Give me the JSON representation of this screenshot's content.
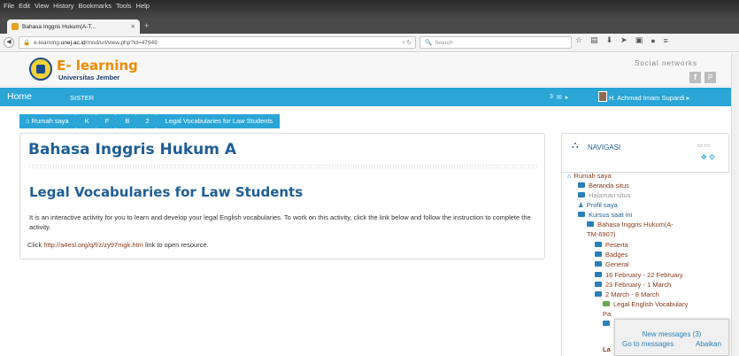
{
  "browser": {
    "menus": [
      "File",
      "Edit",
      "View",
      "History",
      "Bookmarks",
      "Tools",
      "Help"
    ],
    "tab_title": "Bahasa Inggris Hukum(A-T...",
    "url_prefix": "e-learning.",
    "url_host": "unej.ac.id",
    "url_path": "/mod/url/view.php?id=47949",
    "search_placeholder": "Search"
  },
  "site": {
    "logo_title": "E- learning",
    "logo_subtitle": "Universitas Jember",
    "social_label": "Social networks",
    "facebook_glyph": "f",
    "pinterest_glyph": "P"
  },
  "topnav": {
    "home": "Home",
    "sister": "SISTER",
    "messages_count": "3",
    "user_name": "H. Achmad Imam Supardi"
  },
  "breadcrumb": [
    "Rumah saya",
    "K",
    "F",
    "B",
    "2",
    "Legal Vocabularies for Law Students"
  ],
  "main": {
    "course_title": "Bahasa Inggris Hukum A",
    "activity_title": "Legal Vocabularies for Law Students",
    "intro": "It is an interactive activity for you to learn and develop your legal English vocabularies. To work on this activity, click the link below and follow the instruction to complete the activity.",
    "click_prefix": "Click ",
    "link_url": "http://a4esl.org/q/f/z/zy97mgk.htm",
    "click_suffix": " link to open resource."
  },
  "navblock": {
    "title": "NAVIGASI",
    "items": {
      "home": "Rumah saya",
      "beranda": "Beranda situs",
      "halaman": "Halaman situs",
      "profil": "Profil saya",
      "kursus": "Kursus saat ini",
      "course": "Bahasa Inggris Hukum(A-",
      "course_code": "TM-6907)",
      "peserta": "Peserta",
      "badges": "Badges",
      "general": "General",
      "week1": "16 February - 22 February",
      "week2": "23 February - 1 March",
      "week3": "2 March - 8 March",
      "activity1": "Legal English Vocabulary",
      "activity1_cont": "Pa",
      "activity2_cont": "La"
    }
  },
  "popup": {
    "title": "New messages (3)",
    "go": "Go to messages",
    "dismiss": "Abaikan"
  },
  "colors": {
    "accent": "#2aa5d6",
    "heading": "#1f5e96",
    "link": "#8b3a1a",
    "logo": "#f08a00"
  }
}
